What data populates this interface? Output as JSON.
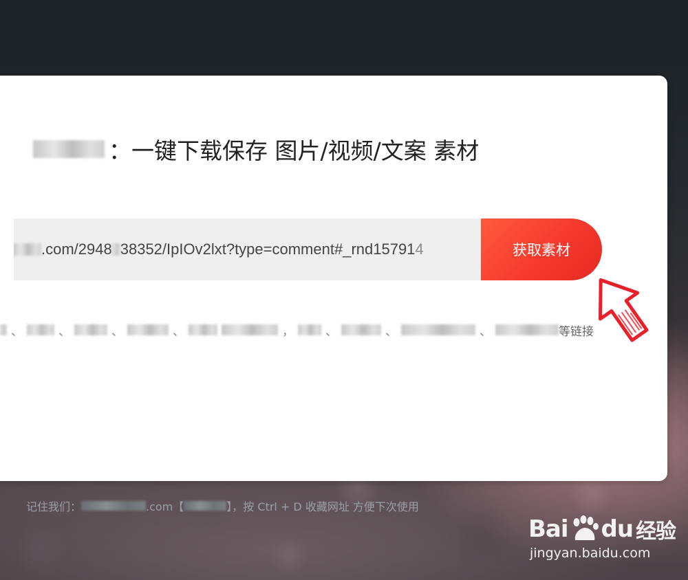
{
  "headline": {
    "title": "：一键下载保存 图片/视频/文案 素材"
  },
  "url_input": {
    "value_part1": ".com/2948",
    "value_part2": "38352/IpIOv2lxt?type=comment#_rnd15791",
    "value_tail": "4"
  },
  "fetch_button": {
    "label": "获取素材"
  },
  "supported_sites": {
    "separator": "、",
    "comma": "，",
    "suffix": "等链接"
  },
  "footer": {
    "prefix": "记住我们：",
    "domain_suffix": ".com【",
    "bracket_close": "】，按 Ctrl + D 收藏网址 方便下次使用"
  },
  "watermark": {
    "brand_left": "Bai",
    "brand_right": "du",
    "brand_cn": "经验",
    "url": "jingyan.baidu.com"
  },
  "colors": {
    "accent": "#f53a2e",
    "input_bg": "#efefef",
    "card_bg": "#ffffff"
  }
}
